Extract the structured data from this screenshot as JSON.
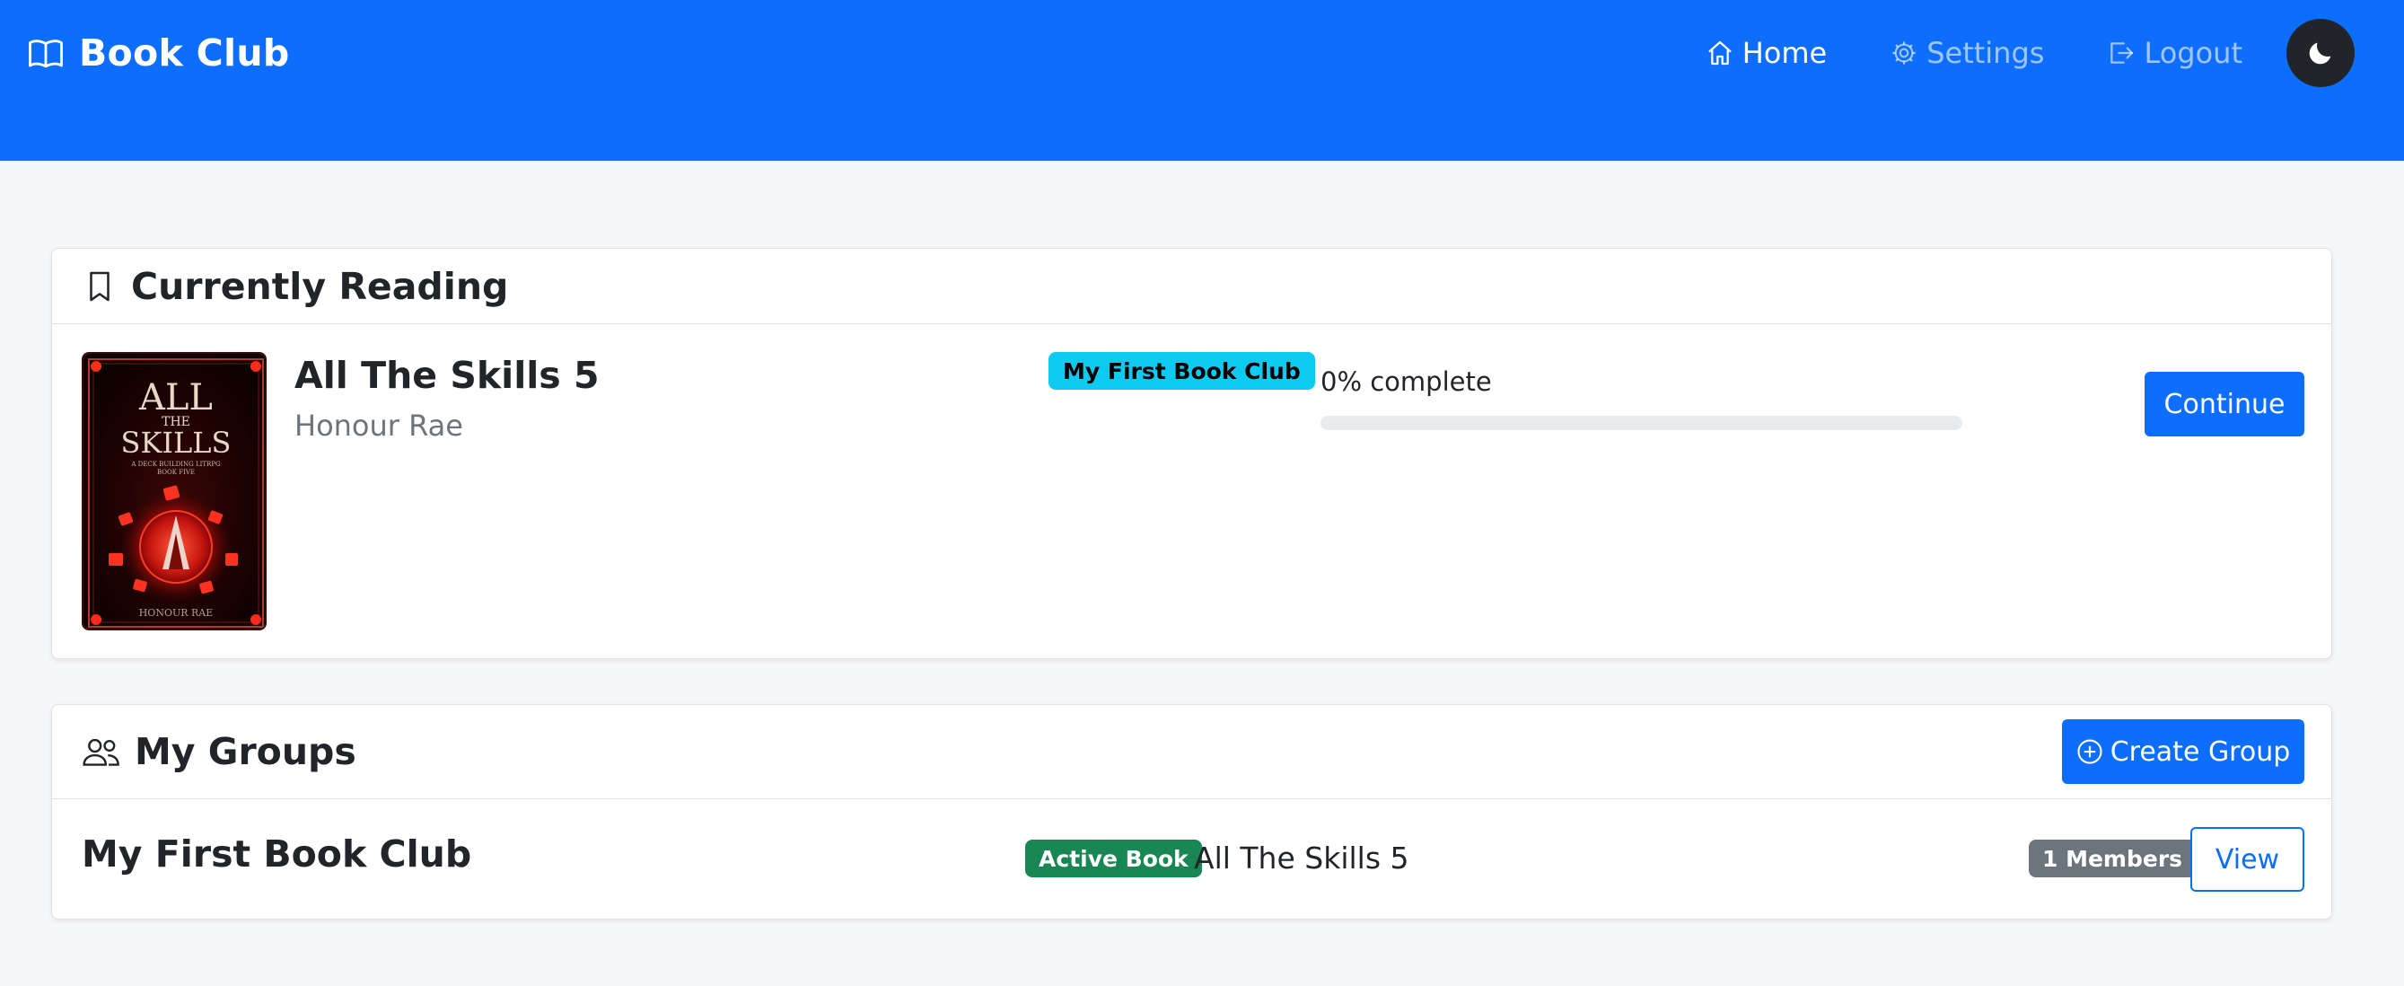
{
  "navbar": {
    "brand": "Book Club",
    "links": [
      {
        "label": "Home",
        "icon": "house-icon",
        "active": true
      },
      {
        "label": "Settings",
        "icon": "gear-icon",
        "active": false
      },
      {
        "label": "Logout",
        "icon": "logout-icon",
        "active": false
      }
    ],
    "theme_toggle_icon": "moon-icon"
  },
  "reading": {
    "header": "Currently Reading",
    "book": {
      "title": "All The Skills 5",
      "author": "Honour Rae",
      "club": "My First Book Club",
      "progress_label": "0% complete",
      "progress_percent": 0,
      "cover": {
        "title_line1": "ALL",
        "title_line2": "THE",
        "title_line3": "SKILLS",
        "subtitle_line1": "A DECK BUILDING LITRPG",
        "subtitle_line2": "BOOK FIVE",
        "author": "HONOUR RAE"
      }
    },
    "continue_label": "Continue"
  },
  "groups": {
    "header": "My Groups",
    "create_label": "Create Group",
    "items": [
      {
        "name": "My First Book Club",
        "active_badge": "Active Book",
        "active_book": "All The Skills 5",
        "members_badge": "1 Members",
        "view_label": "View"
      }
    ]
  },
  "colors": {
    "primary": "#0d6efd",
    "info": "#0dcaf0",
    "success": "#198754",
    "secondary": "#6c757d",
    "dark": "#212529"
  }
}
